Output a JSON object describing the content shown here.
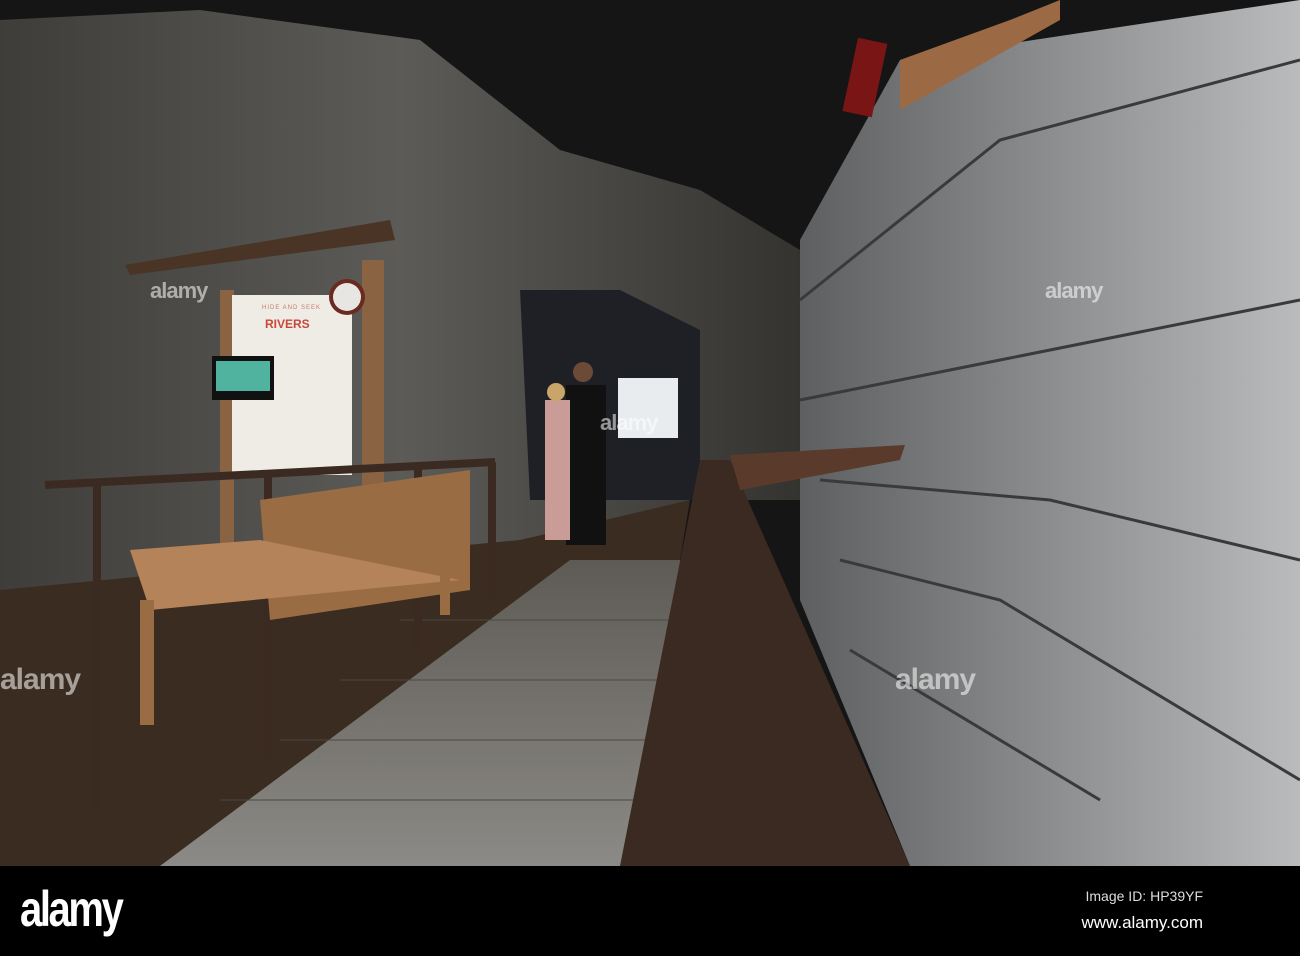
{
  "photo": {
    "sign": {
      "subtitle": "HIDE AND SEEK",
      "title": "RIVERS"
    },
    "watermark": "alamy"
  },
  "footer": {
    "logo": "alamy",
    "image_id": "Image ID: HP39YF",
    "url": "www.alamy.com"
  }
}
